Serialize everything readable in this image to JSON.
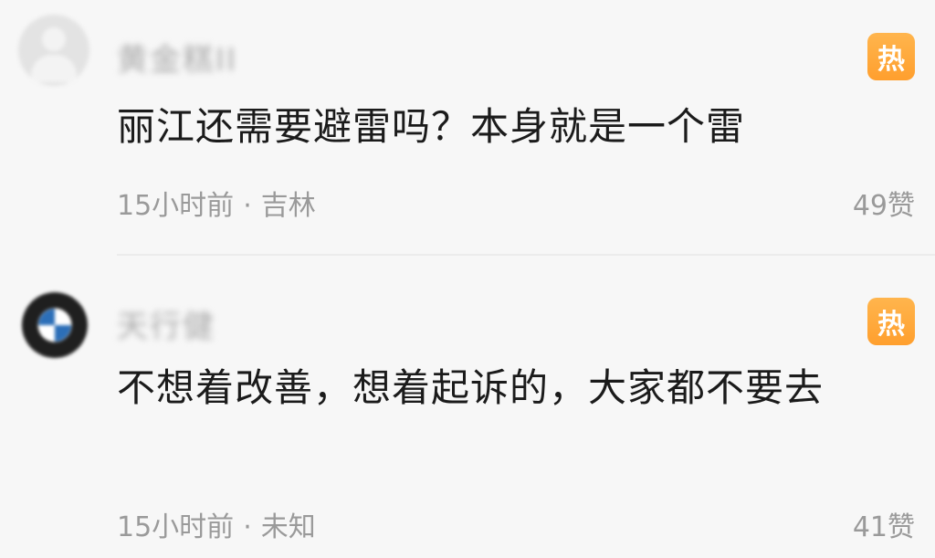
{
  "comments": [
    {
      "username": "黄金糕II",
      "hot_badge": "热",
      "text": "丽江还需要避雷吗？本身就是一个雷",
      "time": "15小时前",
      "separator": "·",
      "location": "吉林",
      "likes": "49赞"
    },
    {
      "username": "天行健",
      "hot_badge": "热",
      "text": "不想着改善，想着起诉的，大家都不要去",
      "time": "15小时前",
      "separator": "·",
      "location": "未知",
      "likes": "41赞"
    }
  ],
  "colors": {
    "hot_badge": "#ffa53a",
    "meta_text": "#9a9a9a",
    "body_text": "#1b1b1b"
  }
}
